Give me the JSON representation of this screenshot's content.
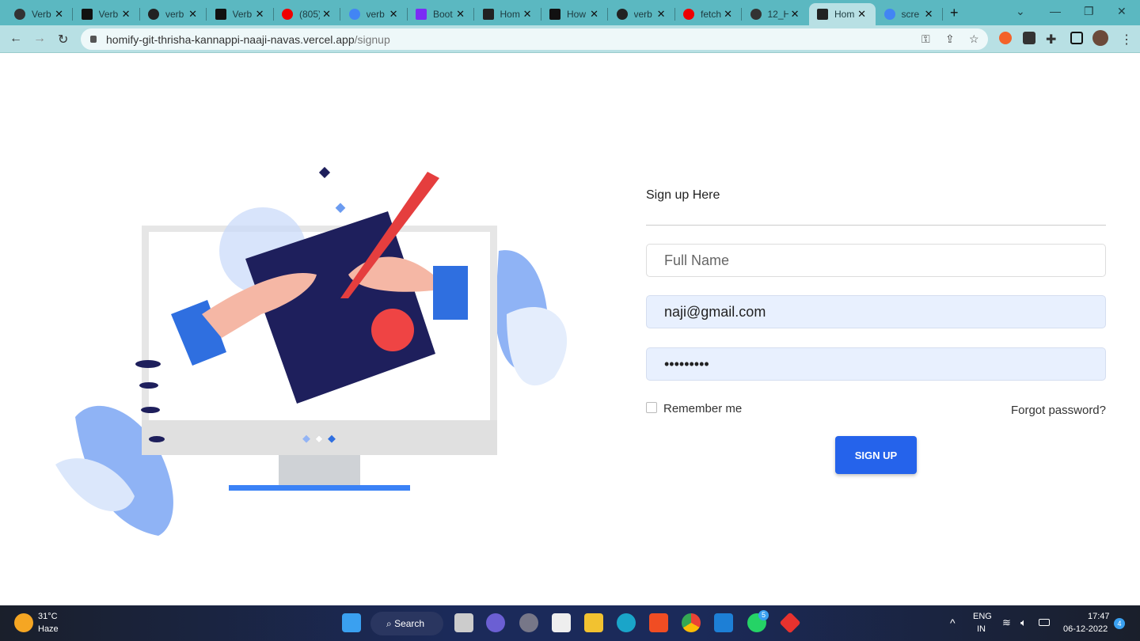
{
  "browser": {
    "tabs": [
      {
        "title": "Verb",
        "icon": "globe-icon"
      },
      {
        "title": "Verb",
        "icon": "arrow-box-icon"
      },
      {
        "title": "verb",
        "icon": "github-icon"
      },
      {
        "title": "Verb",
        "icon": "arrow-box-icon"
      },
      {
        "title": "(805)",
        "icon": "youtube-icon"
      },
      {
        "title": "verb",
        "icon": "google-icon"
      },
      {
        "title": "Boot",
        "icon": "bootstrap-icon"
      },
      {
        "title": "Hom",
        "icon": "react-icon"
      },
      {
        "title": "How",
        "icon": "ad-icon"
      },
      {
        "title": "verb",
        "icon": "github-icon"
      },
      {
        "title": "fetch",
        "icon": "youtube-icon"
      },
      {
        "title": "12_H",
        "icon": "globe-icon"
      },
      {
        "title": "Hom",
        "icon": "react-icon",
        "active": true
      },
      {
        "title": "scre",
        "icon": "google-icon"
      }
    ],
    "url_host": "homify-git-thrisha-kannappi-naaji-navas.vercel.app",
    "url_path": "/signup"
  },
  "form": {
    "title": "Sign up Here",
    "fullname_placeholder": "Full Name",
    "email_value": "naji@gmail.com",
    "password_value": "•••••••••",
    "remember_label": "Remember me",
    "forgot_label": "Forgot password?",
    "submit_label": "SIGN UP",
    "accent": "#2563eb"
  },
  "taskbar": {
    "weather_temp": "31°C",
    "weather_desc": "Haze",
    "search_label": "Search",
    "lang": "ENG",
    "region": "IN",
    "time": "17:47",
    "date": "06-12-2022",
    "whatsapp_badge": "5",
    "notif_count": "4"
  }
}
